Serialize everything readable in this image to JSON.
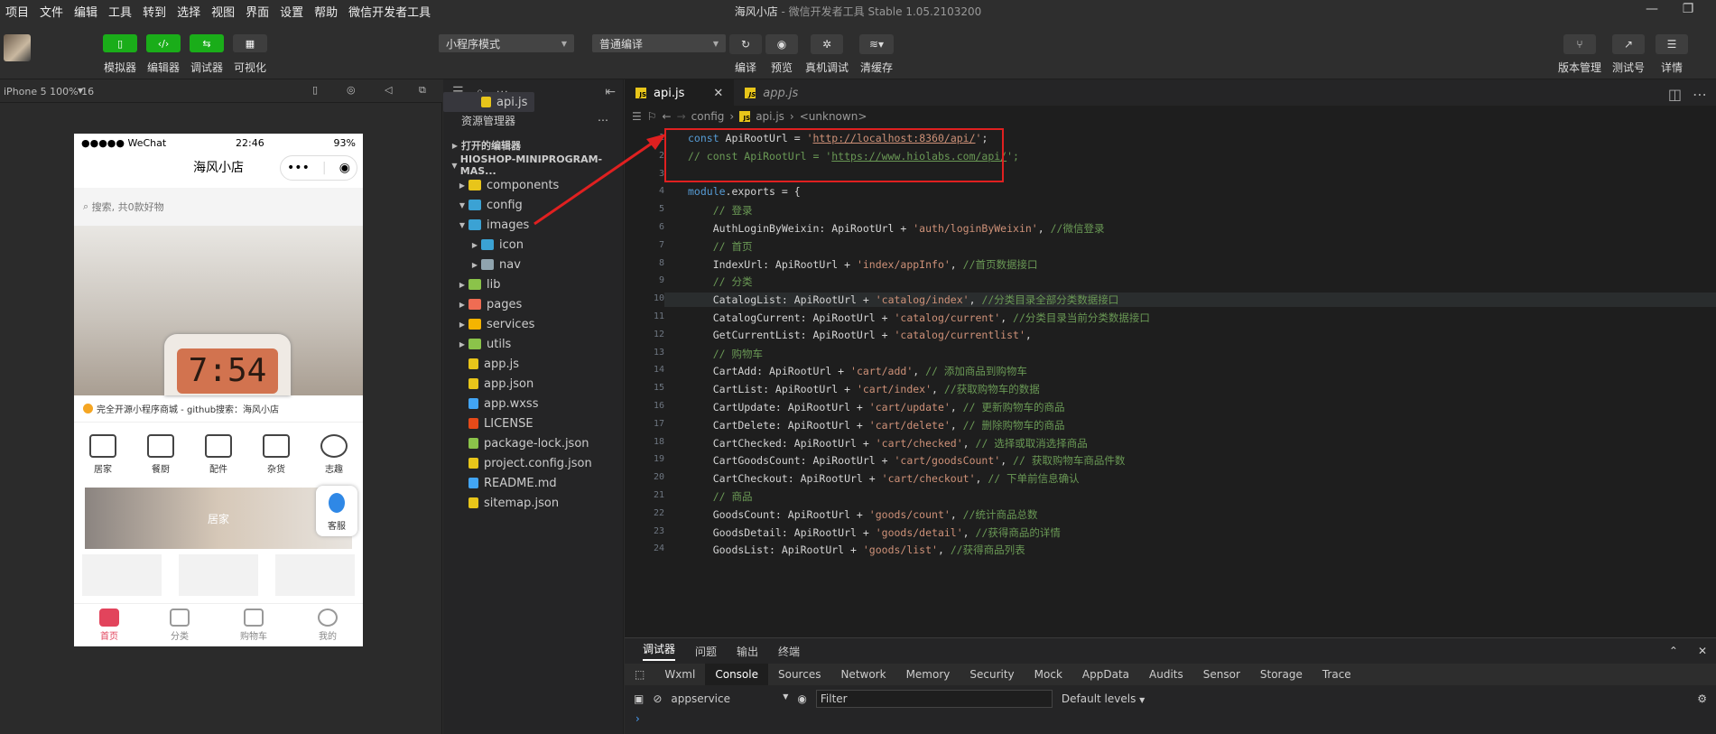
{
  "menu": [
    "项目",
    "文件",
    "编辑",
    "工具",
    "转到",
    "选择",
    "视图",
    "界面",
    "设置",
    "帮助",
    "微信开发者工具"
  ],
  "window": {
    "title_main": "海风小店",
    "title_rest": " - 微信开发者工具 Stable 1.05.2103200"
  },
  "toolbar": {
    "left_buttons": [
      "模拟器",
      "编辑器",
      "调试器",
      "可视化"
    ],
    "mode_select": "小程序模式",
    "compile_select": "普通编译",
    "mid_buttons": [
      "编译",
      "预览",
      "真机调试",
      "清缓存"
    ],
    "right_buttons": [
      "版本管理",
      "测试号",
      "详情"
    ]
  },
  "simulator": {
    "device": "iPhone 5 100% 16",
    "status_left": "●●●●● WeChat",
    "status_time": "22:46",
    "status_battery": "93%",
    "nav_title": "海风小店",
    "search_placeholder": "搜索, 共0款好物",
    "clock_text": "7:54",
    "notice": "完全开源小程序商城 - github搜索：海风小店",
    "categories": [
      "居家",
      "餐厨",
      "配件",
      "杂货",
      "志趣"
    ],
    "banner_label": "居家",
    "kefu": "客服",
    "tabbar": [
      "首页",
      "分类",
      "购物车",
      "我的"
    ]
  },
  "explorer": {
    "title": "资源管理器",
    "open_editors": "打开的编辑器",
    "project": "HIOSHOP-MINIPROGRAM-MAS...",
    "items": [
      {
        "name": "components",
        "indent": 1,
        "kind": "folder",
        "color": "#e8c51a"
      },
      {
        "name": "config",
        "indent": 1,
        "kind": "folder-open",
        "color": "#3ba2d4"
      },
      {
        "name": "api.js",
        "indent": 2,
        "kind": "js",
        "color": "#e8c51a",
        "selected": true
      },
      {
        "name": "images",
        "indent": 1,
        "kind": "folder-open",
        "color": "#3ba2d4"
      },
      {
        "name": "icon",
        "indent": 2,
        "kind": "folder",
        "color": "#3ba2d4"
      },
      {
        "name": "nav",
        "indent": 2,
        "kind": "folder",
        "color": "#90a4ae"
      },
      {
        "name": "lib",
        "indent": 1,
        "kind": "folder",
        "color": "#8bc34a"
      },
      {
        "name": "pages",
        "indent": 1,
        "kind": "folder",
        "color": "#ef6c53"
      },
      {
        "name": "services",
        "indent": 1,
        "kind": "folder",
        "color": "#f4b400"
      },
      {
        "name": "utils",
        "indent": 1,
        "kind": "folder",
        "color": "#8bc34a"
      },
      {
        "name": "app.js",
        "indent": 1,
        "kind": "js",
        "color": "#e8c51a"
      },
      {
        "name": "app.json",
        "indent": 1,
        "kind": "json",
        "color": "#e8c51a"
      },
      {
        "name": "app.wxss",
        "indent": 1,
        "kind": "css",
        "color": "#42a5f5"
      },
      {
        "name": "LICENSE",
        "indent": 1,
        "kind": "lic",
        "color": "#e64a19"
      },
      {
        "name": "package-lock.json",
        "indent": 1,
        "kind": "pkg",
        "color": "#8bc34a"
      },
      {
        "name": "project.config.json",
        "indent": 1,
        "kind": "json",
        "color": "#e8c51a"
      },
      {
        "name": "README.md",
        "indent": 1,
        "kind": "info",
        "color": "#42a5f5"
      },
      {
        "name": "sitemap.json",
        "indent": 1,
        "kind": "json",
        "color": "#e8c51a"
      }
    ]
  },
  "editor": {
    "tabs": [
      "api.js",
      "app.js"
    ],
    "breadcrumb": [
      "config",
      "api.js",
      "<unknown>"
    ],
    "lines": [
      {
        "n": "1",
        "html": "<span class='kw'>const</span> ApiRootUrl = <span class='str'>'<span class=\"url\">http://localhost:8360/api/</span>'</span>;"
      },
      {
        "n": "2",
        "html": "<span class='cm'>// const ApiRootUrl = '<span class=\"url\">https://www.hiolabs.com/api/</span>';</span>"
      },
      {
        "n": "3",
        "html": ""
      },
      {
        "n": "4",
        "html": "<span class='kw'>module</span>.exports = {"
      },
      {
        "n": "5",
        "html": "    <span class='cm'>// 登录</span>"
      },
      {
        "n": "6",
        "html": "    AuthLoginByWeixin: ApiRootUrl + <span class='str'>'auth/loginByWeixin'</span>, <span class='cm'>//微信登录</span>"
      },
      {
        "n": "7",
        "html": "    <span class='cm'>// 首页</span>"
      },
      {
        "n": "8",
        "html": "    IndexUrl: ApiRootUrl + <span class='str'>'index/appInfo'</span>, <span class='cm'>//首页数据接口</span>"
      },
      {
        "n": "9",
        "html": "    <span class='cm'>// 分类</span>"
      },
      {
        "n": "10",
        "html": "    CatalogList: ApiRootUrl + <span class='str'>'catalog/index'</span>, <span class='cm'>//分类目录全部分类数据接口</span>"
      },
      {
        "n": "11",
        "html": "    CatalogCurrent: ApiRootUrl + <span class='str'>'catalog/current'</span>, <span class='cm'>//分类目录当前分类数据接口</span>"
      },
      {
        "n": "12",
        "html": "    GetCurrentList: ApiRootUrl + <span class='str'>'catalog/currentlist'</span>,"
      },
      {
        "n": "13",
        "html": "    <span class='cm'>// 购物车</span>"
      },
      {
        "n": "14",
        "html": "    CartAdd: ApiRootUrl + <span class='str'>'cart/add'</span>, <span class='cm'>// 添加商品到购物车</span>"
      },
      {
        "n": "15",
        "html": "    CartList: ApiRootUrl + <span class='str'>'cart/index'</span>, <span class='cm'>//获取购物车的数据</span>"
      },
      {
        "n": "16",
        "html": "    CartUpdate: ApiRootUrl + <span class='str'>'cart/update'</span>, <span class='cm'>// 更新购物车的商品</span>"
      },
      {
        "n": "17",
        "html": "    CartDelete: ApiRootUrl + <span class='str'>'cart/delete'</span>, <span class='cm'>// 删除购物车的商品</span>"
      },
      {
        "n": "18",
        "html": "    CartChecked: ApiRootUrl + <span class='str'>'cart/checked'</span>, <span class='cm'>// 选择或取消选择商品</span>"
      },
      {
        "n": "19",
        "html": "    CartGoodsCount: ApiRootUrl + <span class='str'>'cart/goodsCount'</span>, <span class='cm'>// 获取购物车商品件数</span>"
      },
      {
        "n": "20",
        "html": "    CartCheckout: ApiRootUrl + <span class='str'>'cart/checkout'</span>, <span class='cm'>// 下单前信息确认</span>"
      },
      {
        "n": "21",
        "html": "    <span class='cm'>// 商品</span>"
      },
      {
        "n": "22",
        "html": "    GoodsCount: ApiRootUrl + <span class='str'>'goods/count'</span>, <span class='cm'>//统计商品总数</span>"
      },
      {
        "n": "23",
        "html": "    GoodsDetail: ApiRootUrl + <span class='str'>'goods/detail'</span>, <span class='cm'>//获得商品的详情</span>"
      },
      {
        "n": "24",
        "html": "    GoodsList: ApiRootUrl + <span class='str'>'goods/list'</span>, <span class='cm'>//获得商品列表</span>"
      }
    ]
  },
  "devtools": {
    "top_tabs": [
      "调试器",
      "问题",
      "输出",
      "终端"
    ],
    "panels": [
      "Wxml",
      "Console",
      "Sources",
      "Network",
      "Memory",
      "Security",
      "Mock",
      "AppData",
      "Audits",
      "Sensor",
      "Storage",
      "Trace"
    ],
    "context": "appservice",
    "filter_placeholder": "Filter",
    "levels": "Default levels"
  },
  "colors": {
    "accent_green": "#1aad19",
    "highlight_red": "#e02020",
    "tab_active_red": "#e2445c"
  }
}
